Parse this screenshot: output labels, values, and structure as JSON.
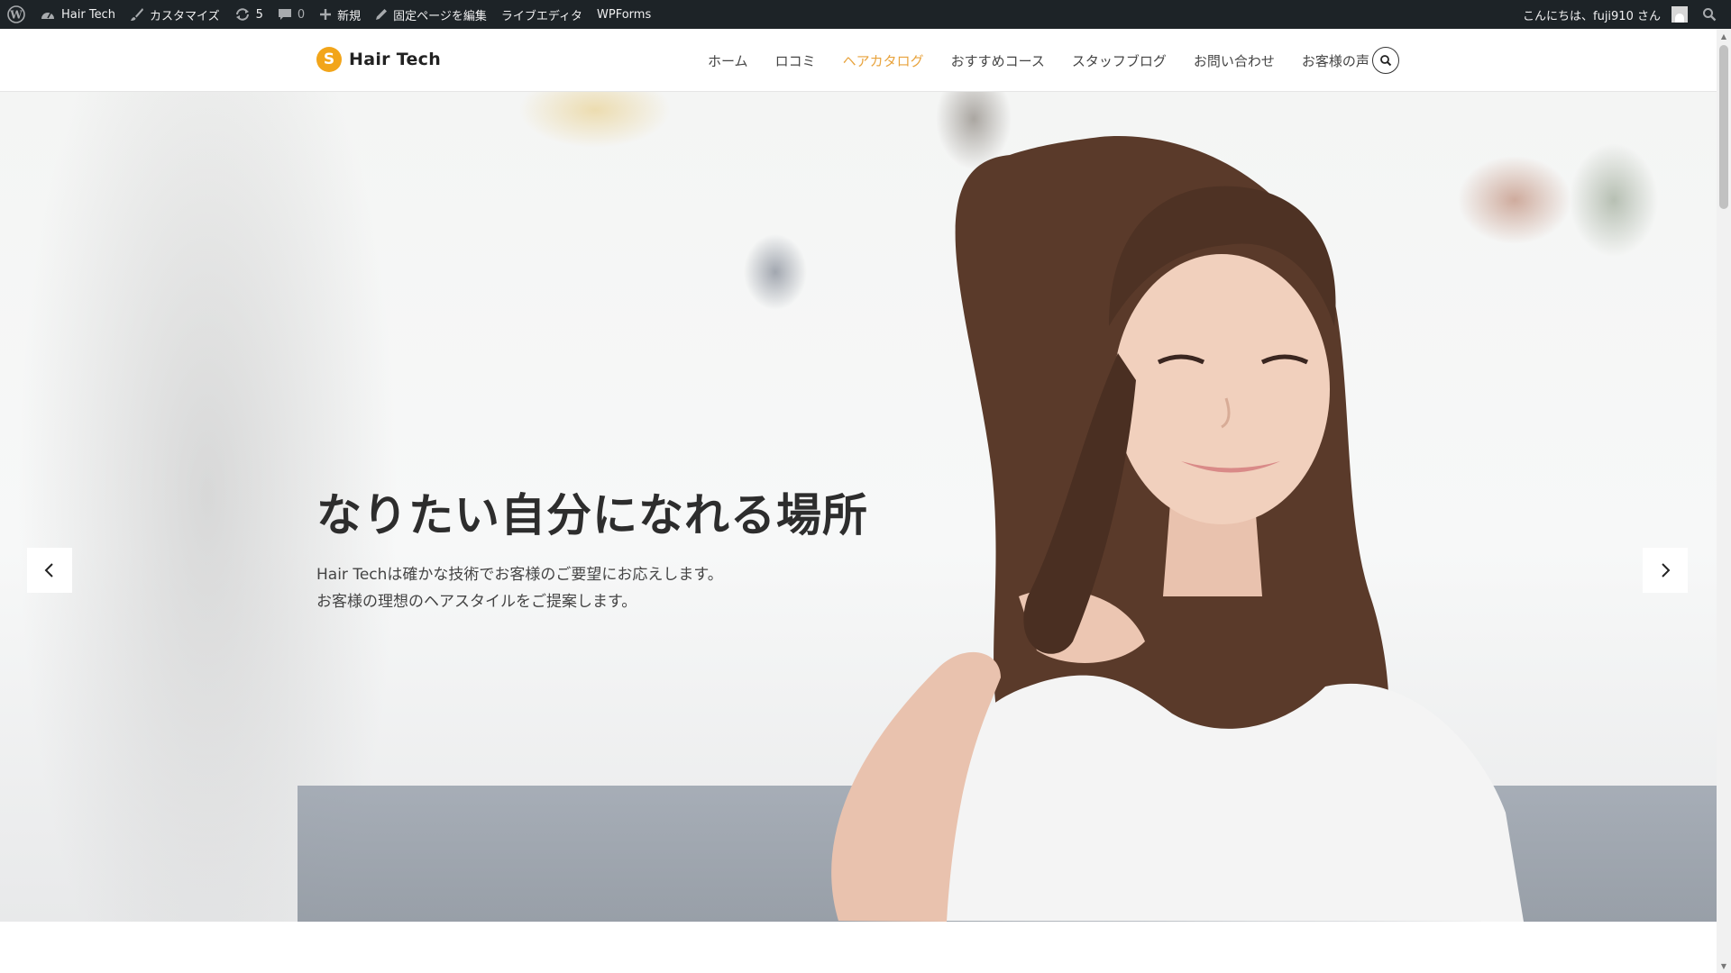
{
  "admin_bar": {
    "site_name": "Hair Tech",
    "customize": "カスタマイズ",
    "updates_count": "5",
    "comments_count": "0",
    "new": "新規",
    "edit_page": "固定ページを編集",
    "live_editor": "ライブエディタ",
    "wpforms": "WPForms",
    "greeting": "こんにちは、fuji910 さん"
  },
  "header": {
    "logo_mark": "S",
    "logo_text": "Hair Tech",
    "nav": [
      "ホーム",
      "ロコミ",
      "ヘアカタログ",
      "おすすめコース",
      "スタッフブログ",
      "お問い合わせ",
      "お客様の声"
    ],
    "active_nav": "ヘアカタログ",
    "accent_color": "#e8a33d"
  },
  "hero": {
    "title": "なりたい自分になれる場所",
    "desc_line1": "Hair Techは確かな技術でお客様のご要望にお応えします。",
    "desc_line2": "お客様の理想のヘアスタイルをご提案します。",
    "prev_icon": "chevron-left-icon",
    "next_icon": "chevron-right-icon"
  }
}
